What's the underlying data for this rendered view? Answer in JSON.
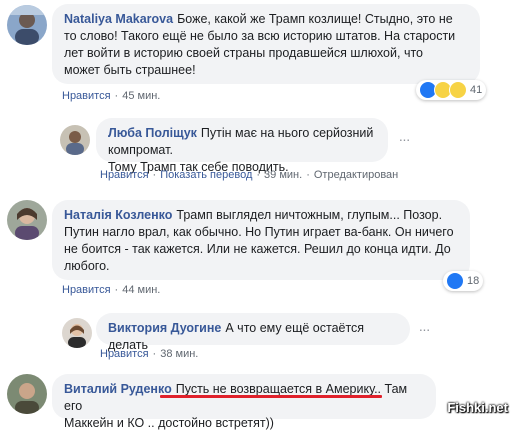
{
  "comments": [
    {
      "author": "Nataliya Makarova",
      "lines": [
        "Боже, какой же Трамп козлище! Стыдно, это не",
        "то слово! Такого ещё не было за всю историю штатов. На старости",
        "лет войти в историю своей страны продавшейся шлюхой, что",
        "может быть страшнее!"
      ],
      "like_label": "Нравится",
      "time": "45 мин.",
      "reactions": [
        "like",
        "haha",
        "sad"
      ],
      "reaction_count": "41"
    },
    {
      "author": "Люба Поліщук",
      "lines": [
        "Путін має на нього серйозний компромат.",
        "Тому Трамп так себе поводить."
      ],
      "like_label": "Нравится",
      "translate_label": "Показать перевод",
      "time": "39 мин.",
      "status": "Отредактирован",
      "reply": true
    },
    {
      "author": "Наталія Козленко",
      "lines": [
        "Трамп выглядел ничтожным, глупым... Позор.",
        "Путин нагло врал, как обычно. Но Путин играет ва-банк. Он ничего",
        "не боится - так кажется. Или не кажется. Решил до конца идти. До",
        "любого."
      ],
      "like_label": "Нравится",
      "time": "44 мин.",
      "reactions": [
        "like"
      ],
      "reaction_count": "18"
    },
    {
      "author": "Виктория Дуогине",
      "lines": [
        "А что ему ещё остаётся делать"
      ],
      "like_label": "Нравится",
      "time": "38 мин.",
      "reply": true
    },
    {
      "author": "Виталий Руденко",
      "line1_pre": "",
      "line1_underlined": "Пусть не возвращается в Америку..",
      "line1_post": " Там его",
      "line2": "Маккейн и КО .. достойно встретят))"
    }
  ],
  "sep": "·",
  "watermark": "Fishki.net",
  "colors": {
    "link": "#385898",
    "bubble": "#f2f3f5",
    "underline": "#e0212b"
  }
}
